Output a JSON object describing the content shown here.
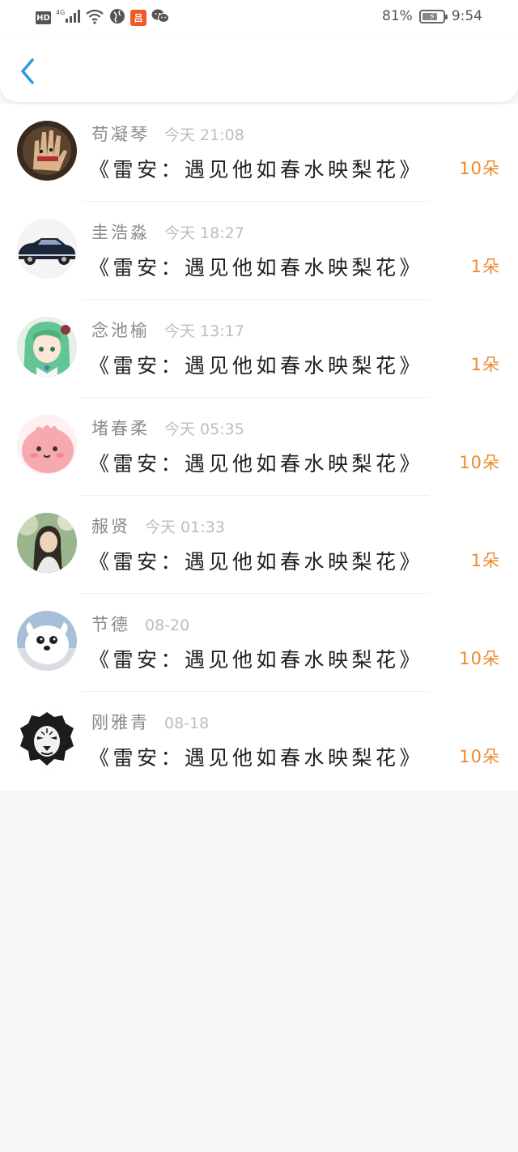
{
  "status_bar": {
    "hd": "HD",
    "network": "4G",
    "app_badge": "吕",
    "battery": "81%",
    "battery_level": 0.81,
    "time": "9:54"
  },
  "header": {
    "back_icon": "chevron-left-icon",
    "accent": "#2f9ae0"
  },
  "colors": {
    "gift": "#ec8a2f",
    "name": "#8a8a8a",
    "time": "#bdbdbd",
    "title": "#222222"
  },
  "items": [
    {
      "name": "苟凝琴",
      "time": "今天 21:08",
      "title": "《雷安：遇见他如春水映梨花》",
      "gift": "10朵",
      "avatar": "hand-avatar"
    },
    {
      "name": "圭浩淼",
      "time": "今天 18:27",
      "title": "《雷安：遇见他如春水映梨花》",
      "gift": "1朵",
      "avatar": "car-avatar"
    },
    {
      "name": "念池榆",
      "time": "今天 13:17",
      "title": "《雷安：遇见他如春水映梨花》",
      "gift": "1朵",
      "avatar": "anime-girl-avatar"
    },
    {
      "name": "堵春柔",
      "time": "今天 05:35",
      "title": "《雷安：遇见他如春水映梨花》",
      "gift": "10朵",
      "avatar": "pink-cartoon-avatar"
    },
    {
      "name": "赧贤",
      "time": "今天 01:33",
      "title": "《雷安：遇见他如春水映梨花》",
      "gift": "1朵",
      "avatar": "girl-photo-avatar"
    },
    {
      "name": "节德",
      "time": "08-20",
      "title": "《雷安：遇见他如春水映梨花》",
      "gift": "10朵",
      "avatar": "white-dog-avatar"
    },
    {
      "name": "刚雅青",
      "time": "08-18",
      "title": "《雷安：遇见他如春水映梨花》",
      "gift": "10朵",
      "avatar": "lion-avatar"
    }
  ]
}
